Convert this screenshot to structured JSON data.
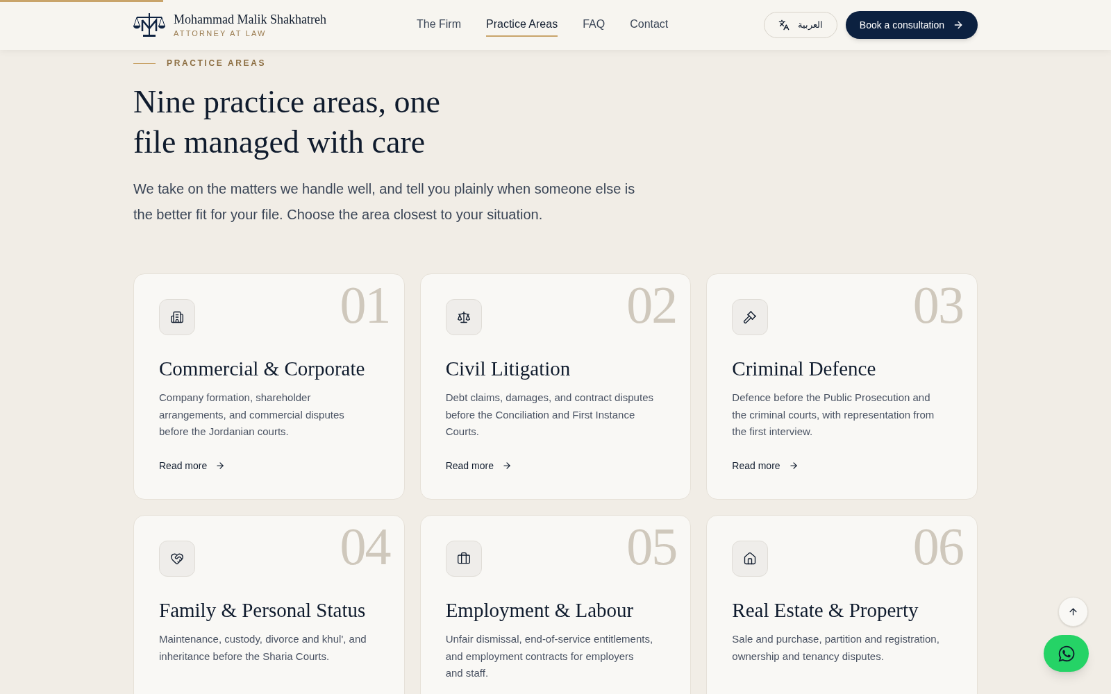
{
  "scroll_progress": {
    "level": 0.147
  },
  "header": {
    "name": "Mohammad Malik Shakhatreh",
    "tagline": "ATTORNEY AT LAW",
    "nav": [
      {
        "label": "The Firm",
        "selected": false
      },
      {
        "label": "Practice Areas",
        "selected": true
      },
      {
        "label": "FAQ",
        "selected": false
      },
      {
        "label": "Contact",
        "selected": false
      }
    ],
    "language_button": "العربية",
    "cta": "Book a consultation"
  },
  "section": {
    "eyebrow": "PRACTICE AREAS",
    "title_lines": [
      "Nine practice areas, one",
      "file managed with care"
    ],
    "intro": "We take on the matters we handle well, and tell you plainly when someone else is the better fit for your file. Choose the area closest to your situation."
  },
  "cards": [
    {
      "number": "01",
      "title": "Commercial & Corporate",
      "description": "Company formation, shareholder arrangements, and commercial disputes before the Jordanian courts.",
      "link": "Read more"
    },
    {
      "number": "02",
      "title": "Civil Litigation",
      "description": "Debt claims, damages, and contract disputes before the Conciliation and First Instance Courts.",
      "link": "Read more"
    },
    {
      "number": "03",
      "title": "Criminal Defence",
      "description": "Defence before the Public Prosecution and the criminal courts, with representation from the first interview.",
      "link": "Read more"
    },
    {
      "number": "04",
      "title": "Family & Personal Status",
      "description": "Maintenance, custody, divorce and khul', and inheritance before the Sharia Courts."
    },
    {
      "number": "05",
      "title": "Employment & Labour",
      "description": "Unfair dismissal, end-of-service entitlements, and employment contracts for employers and staff."
    },
    {
      "number": "06",
      "title": "Real Estate & Property",
      "description": "Sale and purchase, partition and registration, ownership and tenancy disputes."
    }
  ]
}
